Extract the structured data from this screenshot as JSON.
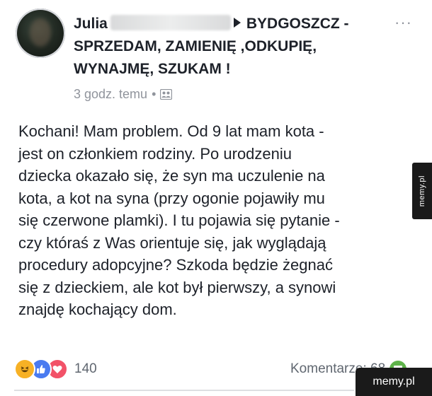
{
  "post": {
    "author_name": "Julia",
    "group_name_line1": "BYDGOSZCZ -",
    "group_name_line2": "SPRZEDAM, ZAMIENIĘ ,ODKUPIĘ,",
    "group_name_line3": "WYNAJMĘ, SZUKAM !",
    "timestamp": "3 godz. temu",
    "separator": "•",
    "privacy_icon": "group-members-icon",
    "more_icon": "more-horizontal-icon",
    "more_label": "···",
    "body": "Kochani! Mam problem. Od 9 lat mam kota -\njest on członkiem rodziny. Po urodzeniu\ndziecka okazało się, że syn ma uczulenie na\nkota, a kot na syna (przy ogonie pojawiły mu\nsię czerwone plamki). I tu pojawia się pytanie -\nczy któraś z Was orientuje się, jak wyglądają\nprocedury adopcyjne? Szkoda będzie żegnać\nsię z dzieckiem, ale kot był pierwszy, a synowi\nznajdę kochający dom."
  },
  "footer": {
    "reactions": [
      "haha-icon",
      "like-icon",
      "love-icon"
    ],
    "reaction_count": "140",
    "comments_label": "Komentarze: 68",
    "comment_icon": "comment-bubble-icon"
  },
  "watermark": {
    "side_text": "memy.pl",
    "corner_text": "memy.pl"
  },
  "colors": {
    "haha": "#f7b125",
    "like": "#4a7bf0",
    "love": "#f25268",
    "comment": "#5fb34a",
    "meta_gray": "#90949c"
  }
}
